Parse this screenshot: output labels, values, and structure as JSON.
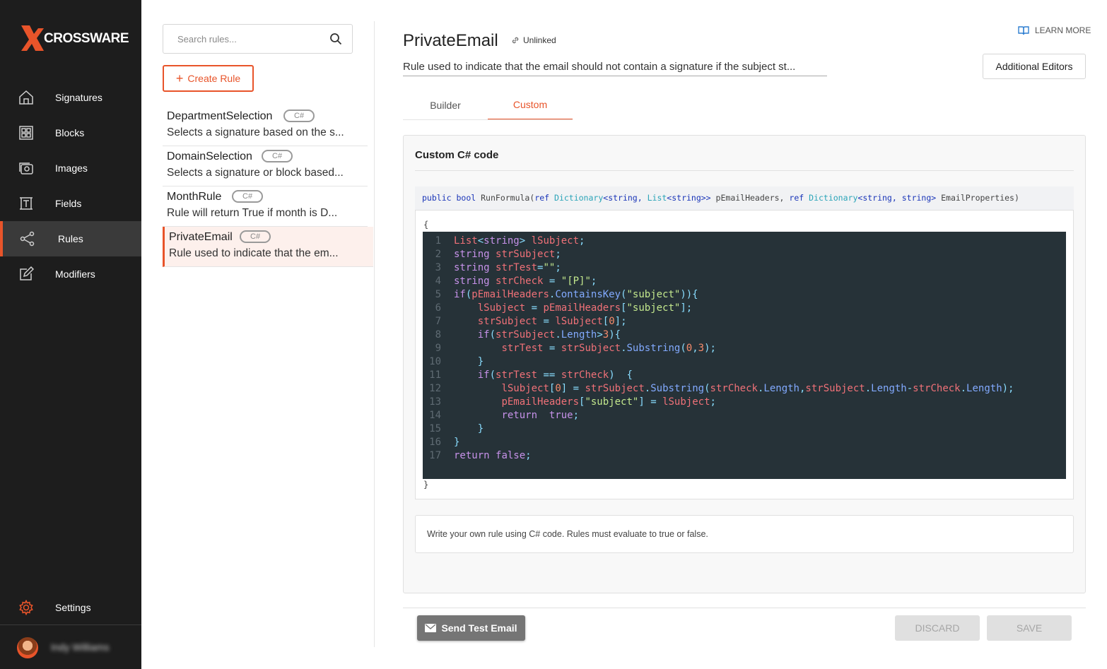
{
  "brand": {
    "name": "CROSSWARE",
    "accent": "#e8542a"
  },
  "sidebar": {
    "items": [
      {
        "label": "Signatures",
        "icon": "home-icon"
      },
      {
        "label": "Blocks",
        "icon": "blocks-icon"
      },
      {
        "label": "Images",
        "icon": "images-icon"
      },
      {
        "label": "Fields",
        "icon": "fields-icon"
      },
      {
        "label": "Rules",
        "icon": "share-nodes-icon",
        "active": true
      },
      {
        "label": "Modifiers",
        "icon": "edit-icon"
      }
    ],
    "settings_label": "Settings",
    "user_name": "Indy Williams"
  },
  "rules_panel": {
    "search_placeholder": "Search rules...",
    "create_label": "Create Rule",
    "rules": [
      {
        "name": "DepartmentSelection",
        "badge": "C#",
        "desc": "Selects a signature based on the s..."
      },
      {
        "name": "DomainSelection",
        "badge": "C#",
        "desc": "Selects a signature or block based..."
      },
      {
        "name": "MonthRule",
        "badge": "C#",
        "desc": "Rule will return True if month is D..."
      },
      {
        "name": "PrivateEmail",
        "badge": "C#",
        "desc": "Rule used to indicate that the em...",
        "active": true
      }
    ]
  },
  "main": {
    "title": "PrivateEmail",
    "link_status": "Unlinked",
    "learn_more": "LEARN MORE",
    "description": "Rule used to indicate that the email should not contain a signature if the subject st...",
    "additional_editors": "Additional Editors",
    "tabs": [
      {
        "label": "Builder"
      },
      {
        "label": "Custom",
        "active": true
      }
    ],
    "card_title": "Custom C# code",
    "signature": {
      "p1": "public",
      "p2": "bool",
      "p3": "RunFormula(",
      "p4": "ref",
      "p5": "Dictionary",
      "p6": "<string,",
      "p7": "List",
      "p8": "<string>>",
      "p9": "pEmailHeaders,",
      "p10": "ref",
      "p11": "Dictionary",
      "p12": "<string,",
      "p13": "string>",
      "p14": "EmailProperties)"
    },
    "open_brace": "{",
    "close_brace": "}",
    "code_lines": [
      "List<string> lSubject;",
      "string strSubject;",
      "string strTest=\"\";",
      "string strCheck = \"[P]\";",
      "if(pEmailHeaders.ContainsKey(\"subject\")){",
      "    lSubject = pEmailHeaders[\"subject\"];",
      "    strSubject = lSubject[0];",
      "    if(strSubject.Length>3){",
      "        strTest = strSubject.Substring(0,3);",
      "    }",
      "    if(strTest == strCheck)  {",
      "        lSubject[0] = strSubject.Substring(strCheck.Length,strSubject.Length-strCheck.Length);",
      "        pEmailHeaders[\"subject\"] = lSubject;",
      "        return  true;",
      "    }",
      "}",
      "return false;"
    ],
    "hint": "Write your own rule using C# code. Rules must evaluate to true or false.",
    "send_test_label": "Send Test Email",
    "discard_label": "DISCARD",
    "save_label": "SAVE"
  }
}
